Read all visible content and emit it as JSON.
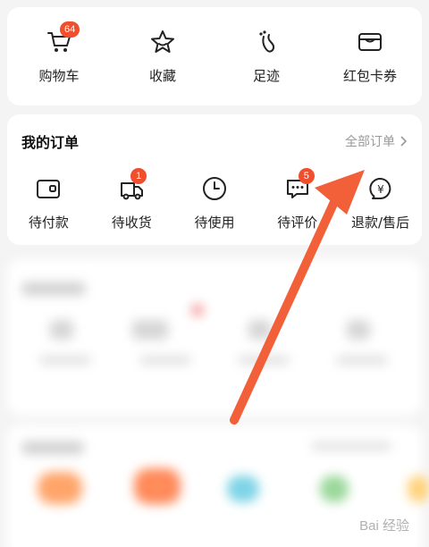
{
  "quick_actions": [
    {
      "label": "购物车",
      "icon": "cart-icon",
      "badge": "64"
    },
    {
      "label": "收藏",
      "icon": "star-icon"
    },
    {
      "label": "足迹",
      "icon": "footprint-icon"
    },
    {
      "label": "红包卡券",
      "icon": "coupon-icon"
    }
  ],
  "orders": {
    "title": "我的订单",
    "view_all": "全部订单",
    "items": [
      {
        "label": "待付款",
        "icon": "wallet-icon"
      },
      {
        "label": "待收货",
        "icon": "truck-icon",
        "badge": "1"
      },
      {
        "label": "待使用",
        "icon": "clock-icon"
      },
      {
        "label": "待评价",
        "icon": "comment-icon",
        "badge": "5"
      },
      {
        "label": "退款/售后",
        "icon": "refund-icon"
      }
    ]
  },
  "watermark": "Bai 经验",
  "colors": {
    "badge": "#f04e2d",
    "arrow": "#f2603a",
    "muted_text": "#999999"
  }
}
